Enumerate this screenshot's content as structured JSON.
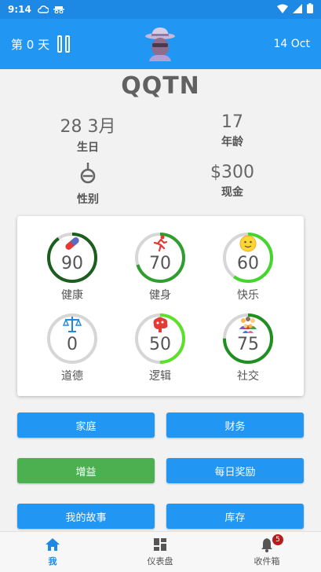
{
  "status_bar": {
    "time": "9:14"
  },
  "app_bar": {
    "day_label": "第 0 天",
    "date": "14 Oct"
  },
  "profile": {
    "name": "QQTN",
    "birthday": {
      "value": "28 3月",
      "label": "生日"
    },
    "age": {
      "value": "17",
      "label": "年龄"
    },
    "gender": {
      "label": "性别"
    },
    "cash": {
      "value": "$300",
      "label": "现金"
    }
  },
  "stats": [
    {
      "label": "健康",
      "value": "90",
      "level": 0.9,
      "color": "#1b5e20",
      "icon": "pill-icon"
    },
    {
      "label": "健身",
      "value": "70",
      "level": 0.7,
      "color": "#2e9e2e",
      "icon": "runner-icon"
    },
    {
      "label": "快乐",
      "value": "60",
      "level": 0.6,
      "color": "#43d62c",
      "icon": "smiley-icon"
    },
    {
      "label": "道德",
      "value": "0",
      "level": 0.0,
      "color": "#9e9e9e",
      "icon": "scales-icon"
    },
    {
      "label": "逻辑",
      "value": "50",
      "level": 0.5,
      "color": "#5de02a",
      "icon": "brain-icon"
    },
    {
      "label": "社交",
      "value": "75",
      "level": 0.75,
      "color": "#1f8f1f",
      "icon": "people-icon"
    }
  ],
  "buttons": {
    "family": "家庭",
    "finance": "财务",
    "boost": "增益",
    "daily_reward": "每日奖励",
    "my_story": "我的故事",
    "inventory": "库存"
  },
  "bottom_nav": {
    "me": "我",
    "dashboard": "仪表盘",
    "inbox": "收件箱",
    "inbox_badge": "5"
  },
  "colors": {
    "primary": "#2196f3",
    "status_bar": "#1e88e5",
    "green_button": "#4caf50",
    "badge": "#b71c1c"
  }
}
